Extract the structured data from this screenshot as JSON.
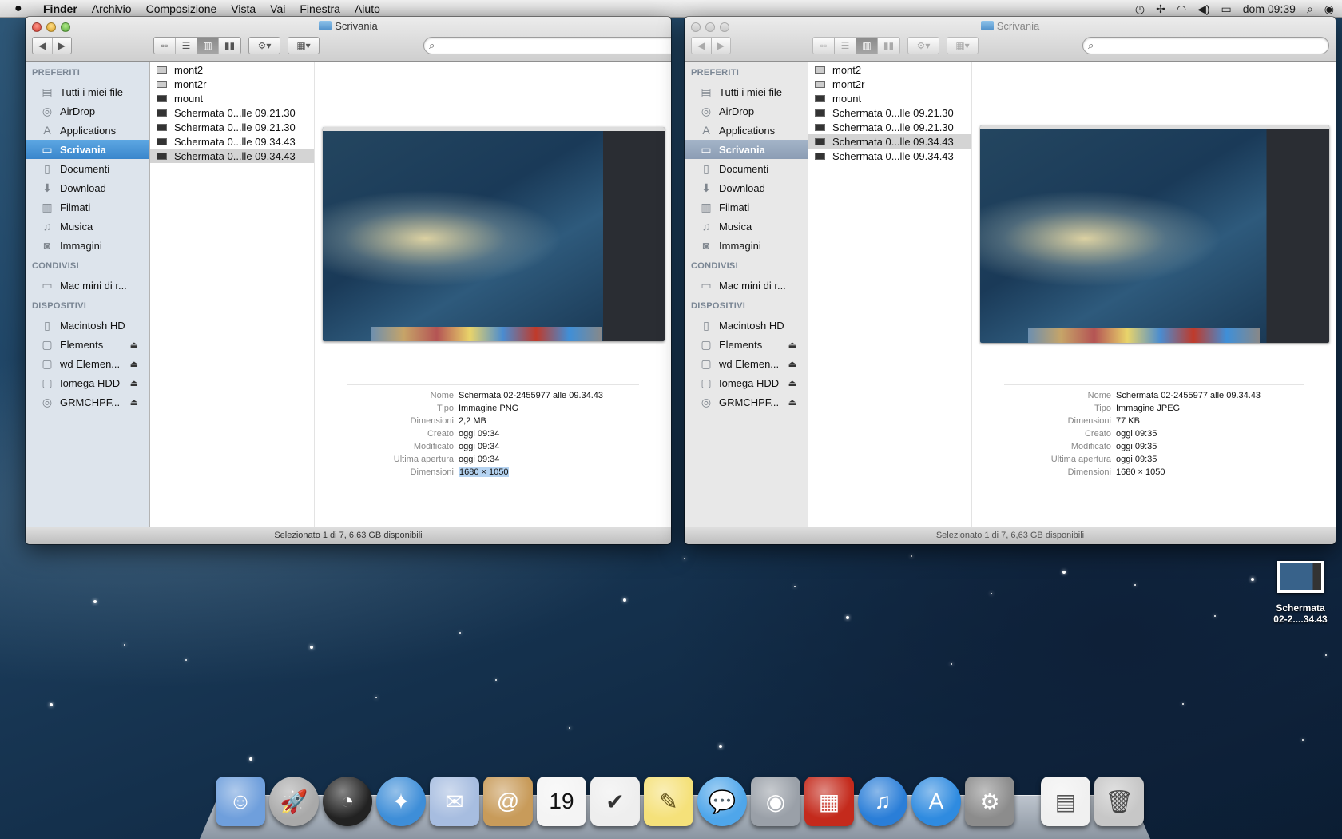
{
  "menubar": {
    "apple": "",
    "app": "Finder",
    "items": [
      "Archivio",
      "Composizione",
      "Vista",
      "Vai",
      "Finestra",
      "Aiuto"
    ],
    "clock": "dom 09:39",
    "status_icons": [
      "time-machine-icon",
      "bluetooth-icon",
      "wifi-icon",
      "volume-icon",
      "battery-icon",
      "spotlight-icon",
      "notification-center-icon"
    ]
  },
  "windows": [
    {
      "title": "Scrivania",
      "active": true,
      "search_placeholder": "",
      "sidebar": {
        "sections": [
          {
            "header": "PREFERITI",
            "items": [
              {
                "label": "Tutti i miei file",
                "icon": "all-files-icon"
              },
              {
                "label": "AirDrop",
                "icon": "airdrop-icon"
              },
              {
                "label": "Applications",
                "icon": "applications-icon"
              },
              {
                "label": "Scrivania",
                "icon": "desktop-icon",
                "selected": true
              },
              {
                "label": "Documenti",
                "icon": "documents-icon"
              },
              {
                "label": "Download",
                "icon": "download-icon"
              },
              {
                "label": "Filmati",
                "icon": "movies-icon"
              },
              {
                "label": "Musica",
                "icon": "music-icon"
              },
              {
                "label": "Immagini",
                "icon": "pictures-icon"
              }
            ]
          },
          {
            "header": "CONDIVISI",
            "items": [
              {
                "label": "Mac mini di r...",
                "icon": "shared-computer-icon"
              }
            ]
          },
          {
            "header": "DISPOSITIVI",
            "items": [
              {
                "label": "Macintosh HD",
                "icon": "hard-disk-icon"
              },
              {
                "label": "Elements",
                "icon": "external-disk-icon",
                "eject": true
              },
              {
                "label": "wd Elemen...",
                "icon": "external-disk-icon",
                "eject": true
              },
              {
                "label": "Iomega HDD",
                "icon": "external-disk-icon",
                "eject": true
              },
              {
                "label": "GRMCHPF...",
                "icon": "optical-disc-icon",
                "eject": true
              }
            ]
          }
        ]
      },
      "files": [
        "mont2",
        "mont2r",
        "mount",
        "Schermata 0...lle 09.21.30",
        "Schermata 0...lle 09.21.30",
        "Schermata 0...lle 09.34.43",
        "Schermata 0...lle 09.34.43"
      ],
      "selected_file_index": 6,
      "info": [
        {
          "k": "Nome",
          "v": "Schermata 02-2455977 alle 09.34.43"
        },
        {
          "k": "Tipo",
          "v": "Immagine PNG"
        },
        {
          "k": "Dimensioni",
          "v": "2,2 MB"
        },
        {
          "k": "Creato",
          "v": "oggi 09:34"
        },
        {
          "k": "Modificato",
          "v": "oggi 09:34"
        },
        {
          "k": "Ultima apertura",
          "v": "oggi 09:34"
        },
        {
          "k": "Dimensioni",
          "v": "1680 × 1050",
          "highlight": true
        }
      ],
      "status": "Selezionato 1 di 7, 6,63 GB disponibili"
    },
    {
      "title": "Scrivania",
      "active": false,
      "search_placeholder": "",
      "sidebar": {
        "sections": [
          {
            "header": "PREFERITI",
            "items": [
              {
                "label": "Tutti i miei file",
                "icon": "all-files-icon"
              },
              {
                "label": "AirDrop",
                "icon": "airdrop-icon"
              },
              {
                "label": "Applications",
                "icon": "applications-icon"
              },
              {
                "label": "Scrivania",
                "icon": "desktop-icon",
                "selected": true
              },
              {
                "label": "Documenti",
                "icon": "documents-icon"
              },
              {
                "label": "Download",
                "icon": "download-icon"
              },
              {
                "label": "Filmati",
                "icon": "movies-icon"
              },
              {
                "label": "Musica",
                "icon": "music-icon"
              },
              {
                "label": "Immagini",
                "icon": "pictures-icon"
              }
            ]
          },
          {
            "header": "CONDIVISI",
            "items": [
              {
                "label": "Mac mini di r...",
                "icon": "shared-computer-icon"
              }
            ]
          },
          {
            "header": "DISPOSITIVI",
            "items": [
              {
                "label": "Macintosh HD",
                "icon": "hard-disk-icon"
              },
              {
                "label": "Elements",
                "icon": "external-disk-icon",
                "eject": true
              },
              {
                "label": "wd Elemen...",
                "icon": "external-disk-icon",
                "eject": true
              },
              {
                "label": "Iomega HDD",
                "icon": "external-disk-icon",
                "eject": true
              },
              {
                "label": "GRMCHPF...",
                "icon": "optical-disc-icon",
                "eject": true
              }
            ]
          }
        ]
      },
      "files": [
        "mont2",
        "mont2r",
        "mount",
        "Schermata 0...lle 09.21.30",
        "Schermata 0...lle 09.21.30",
        "Schermata 0...lle 09.34.43",
        "Schermata 0...lle 09.34.43"
      ],
      "selected_file_index": 5,
      "info": [
        {
          "k": "Nome",
          "v": "Schermata 02-2455977 alle 09.34.43"
        },
        {
          "k": "Tipo",
          "v": "Immagine JPEG"
        },
        {
          "k": "Dimensioni",
          "v": "77 KB"
        },
        {
          "k": "Creato",
          "v": "oggi 09:35"
        },
        {
          "k": "Modificato",
          "v": "oggi 09:35"
        },
        {
          "k": "Ultima apertura",
          "v": "oggi 09:35"
        },
        {
          "k": "Dimensioni",
          "v": "1680 × 1050"
        }
      ],
      "status": "Selezionato 1 di 7, 6,63 GB disponibili"
    }
  ],
  "desktop_icon": {
    "label_line1": "Schermata",
    "label_line2": "02-2....34.43"
  },
  "dock": [
    {
      "name": "Finder",
      "icon": "finder-icon",
      "color": "#6f9fdc",
      "glyph": "☺"
    },
    {
      "name": "Launchpad",
      "icon": "launchpad-icon",
      "color": "#a9a9a9",
      "glyph": "🚀",
      "round": true
    },
    {
      "name": "Dashboard",
      "icon": "dashboard-icon",
      "color": "#222222",
      "glyph": "◔",
      "round": true
    },
    {
      "name": "Safari",
      "icon": "safari-icon",
      "color": "#3e8ed8",
      "glyph": "✦",
      "round": true
    },
    {
      "name": "Mail",
      "icon": "mail-icon",
      "color": "#a7bde0",
      "glyph": "✉"
    },
    {
      "name": "Contatti",
      "icon": "contacts-icon",
      "color": "#c89b5a",
      "glyph": "@"
    },
    {
      "name": "Calendario",
      "icon": "calendar-icon",
      "color": "#f4f4f4",
      "glyph": "19",
      "text_color": "#111"
    },
    {
      "name": "Promemoria",
      "icon": "reminders-icon",
      "color": "#eeeeee",
      "glyph": "✔",
      "text_color": "#333"
    },
    {
      "name": "Note",
      "icon": "notes-icon",
      "color": "#f5e17a",
      "glyph": "✎",
      "text_color": "#6a5a20"
    },
    {
      "name": "Messaggi",
      "icon": "messages-icon",
      "color": "#4fa6ea",
      "glyph": "💬",
      "round": true
    },
    {
      "name": "FaceTime",
      "icon": "facetime-icon",
      "color": "#9aa0a8",
      "glyph": "◉"
    },
    {
      "name": "Photo Booth",
      "icon": "photo-booth-icon",
      "color": "#c42a1c",
      "glyph": "▦"
    },
    {
      "name": "iTunes",
      "icon": "itunes-icon",
      "color": "#2a7ed8",
      "glyph": "♫",
      "round": true
    },
    {
      "name": "App Store",
      "icon": "app-store-icon",
      "color": "#2f8be0",
      "glyph": "A",
      "round": true
    },
    {
      "name": "Preferenze di Sistema",
      "icon": "system-preferences-icon",
      "color": "#8c8c8c",
      "glyph": "⚙"
    },
    {
      "name": "Documento",
      "icon": "document-icon",
      "color": "#f0f0f0",
      "glyph": "▤",
      "text_color": "#555",
      "gap": true
    },
    {
      "name": "Cestino",
      "icon": "trash-icon",
      "color": "#c7c7c7",
      "glyph": "🗑",
      "text_color": "#444"
    }
  ]
}
